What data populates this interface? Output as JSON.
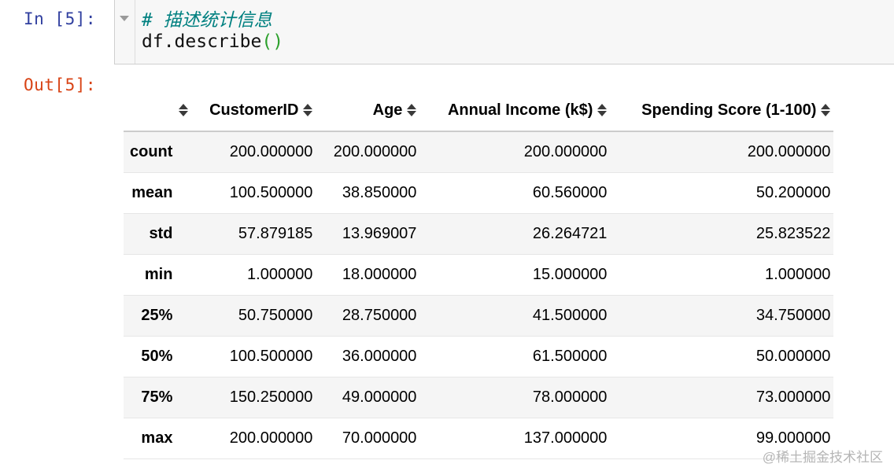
{
  "input_cell": {
    "prompt": "In [5]:",
    "code_comment": "# 描述统计信息",
    "code_call_prefix": "df.describe",
    "code_paren_open": "(",
    "code_paren_close": ")"
  },
  "output_cell": {
    "prompt": "Out[5]:"
  },
  "table": {
    "columns": [
      "",
      "CustomerID",
      "Age",
      "Annual Income (k$)",
      "Spending Score (1-100)"
    ],
    "rows": [
      {
        "label": "count",
        "values": [
          "200.000000",
          "200.000000",
          "200.000000",
          "200.000000"
        ]
      },
      {
        "label": "mean",
        "values": [
          "100.500000",
          "38.850000",
          "60.560000",
          "50.200000"
        ]
      },
      {
        "label": "std",
        "values": [
          "57.879185",
          "13.969007",
          "26.264721",
          "25.823522"
        ]
      },
      {
        "label": "min",
        "values": [
          "1.000000",
          "18.000000",
          "15.000000",
          "1.000000"
        ]
      },
      {
        "label": "25%",
        "values": [
          "50.750000",
          "28.750000",
          "41.500000",
          "34.750000"
        ]
      },
      {
        "label": "50%",
        "values": [
          "100.500000",
          "36.000000",
          "61.500000",
          "50.000000"
        ]
      },
      {
        "label": "75%",
        "values": [
          "150.250000",
          "49.000000",
          "78.000000",
          "73.000000"
        ]
      },
      {
        "label": "max",
        "values": [
          "200.000000",
          "70.000000",
          "137.000000",
          "99.000000"
        ]
      }
    ]
  },
  "watermark": "@稀土掘金技术社区",
  "colors": {
    "in_prompt": "#303f9f",
    "out_prompt": "#d84315",
    "comment": "#008080",
    "paren": "#2ca02c",
    "stripe": "#f5f5f5"
  },
  "icons": {
    "sort": "sort-updown-icon",
    "fold": "fold-arrow-icon"
  }
}
